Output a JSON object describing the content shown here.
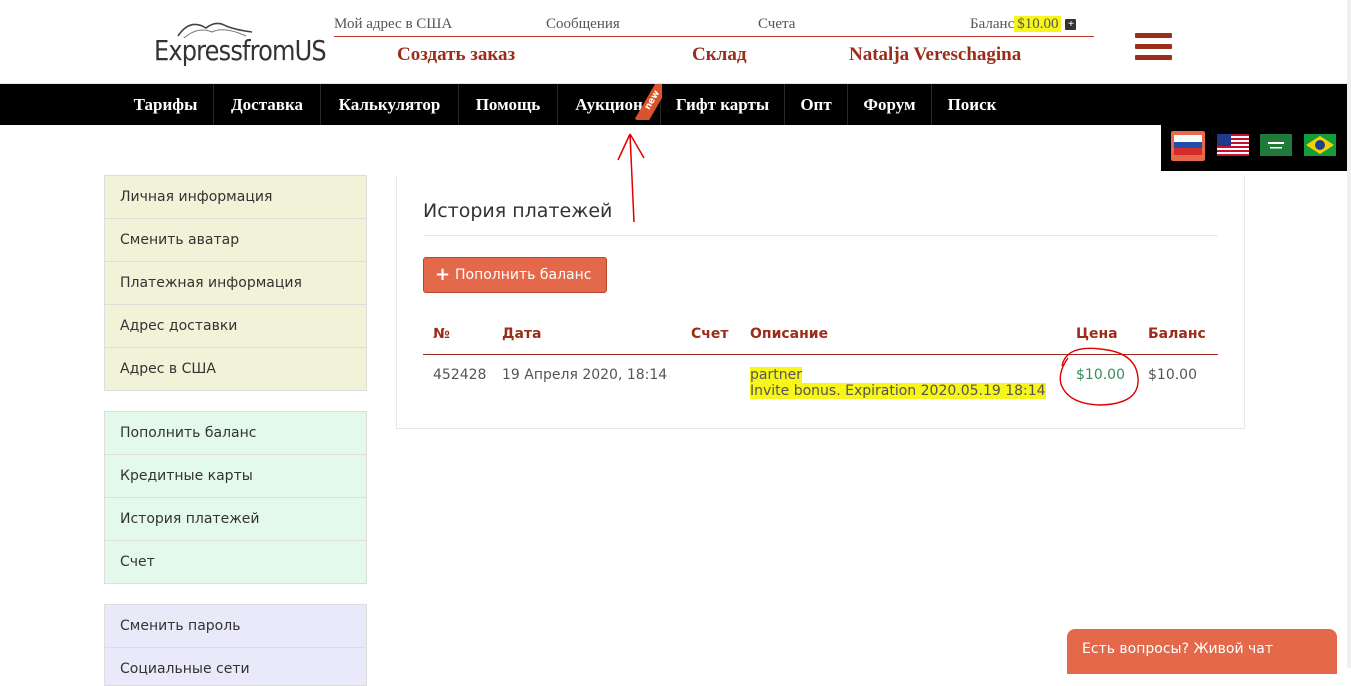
{
  "header": {
    "logo_text": "ExpressfromUS",
    "top_links": {
      "address_usa": "Мой адрес в США",
      "messages": "Сообщения",
      "invoices": "Счета",
      "balance_label": "Баланс",
      "balance_value": "$10.00",
      "plus_symbol": "+"
    },
    "create_order": "Создать заказ",
    "warehouse": "Склад",
    "user_name": "Natalja Vereschagina"
  },
  "nav": {
    "items": [
      "Тарифы",
      "Доставка",
      "Калькулятор",
      "Помощь",
      "Аукцион",
      "Гифт карты",
      "Опт",
      "Форум",
      "Поиск"
    ],
    "new_badge": "new"
  },
  "languages": [
    "ru-flag",
    "us-flag",
    "sa-flag",
    "br-flag"
  ],
  "sidebar": {
    "group1": [
      "Личная информация",
      "Сменить аватар",
      "Платежная информация",
      "Адрес доставки",
      "Адрес в США"
    ],
    "group2": [
      "Пополнить баланс",
      "Кредитные карты",
      "История платежей",
      "Счет"
    ],
    "group3": [
      "Сменить пароль",
      "Социальные сети"
    ]
  },
  "main": {
    "title": "История платежей",
    "topup_button": "Пополнить баланс",
    "topup_icon": "+",
    "table": {
      "headers": {
        "num": "№",
        "date": "Дата",
        "invoice": "Счет",
        "description": "Описание",
        "price": "Цена",
        "balance": "Баланс"
      },
      "rows": [
        {
          "num": "452428",
          "date": "19 Апреля 2020, 18:14",
          "invoice": "",
          "desc_line1": "partner",
          "desc_line2": "Invite bonus. Expiration 2020.05.19 18:14",
          "price": "$10.00",
          "balance": "$10.00"
        }
      ]
    }
  },
  "chat": {
    "label": "Есть вопросы? Живой чат"
  },
  "colors": {
    "brand": "#9b2d1a",
    "accent": "#e4694a",
    "highlight": "#f7f51a",
    "annotation": "#e00000"
  }
}
